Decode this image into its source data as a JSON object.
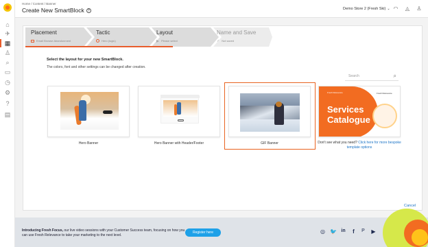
{
  "header": {
    "breadcrumb": "Home / Content / Banner",
    "title": "Create New SmartBlock",
    "help_glyph": "?",
    "store": "Demo Store 2 (Fresh Ski)",
    "store_caret": "⌄"
  },
  "stepper": {
    "steps": [
      {
        "label": "Placement",
        "sub": "Email Browse Abandonment",
        "state": "done"
      },
      {
        "label": "Tactic",
        "sub": "Hero (logic)",
        "state": "done"
      },
      {
        "label": "Layout",
        "sub": "Please select",
        "state": "current"
      },
      {
        "label": "Name and Save",
        "sub": "Not saved",
        "state": "pending"
      }
    ]
  },
  "intro": {
    "line1": "Select the layout for your new SmartBlock.",
    "line2": "The colors, font and other settings can be changed after creation."
  },
  "search": {
    "placeholder": "Search"
  },
  "tiles": [
    {
      "caption": "Hero Banner",
      "selected": false
    },
    {
      "caption": "Hero Banner with Header/Footer",
      "selected": false
    },
    {
      "caption": "GIF Banner",
      "selected": true
    },
    {
      "caption_plain": "Don't see what you need?",
      "caption_link": "Click here for more bespoke template options",
      "thumb_title_1": "Services",
      "thumb_title_2": "Catalogue",
      "thumb_brand": "Fresh Relevance",
      "thumb_brand_2": "Fresh Relevance"
    }
  ],
  "actions": {
    "cancel": "Cancel"
  },
  "footer": {
    "bold": "Introducing Fresh Focus,",
    "text": " our live video sessions with your Customer Success team, focusing on how you can use Fresh Relevance to take your marketing to the next level.",
    "register": "Register here",
    "social": [
      "◎",
      "🐦",
      "in",
      "f",
      "P",
      "▶"
    ]
  },
  "colors": {
    "accent": "#e8621f",
    "link": "#1a73c6",
    "register": "#1ea1e8"
  }
}
